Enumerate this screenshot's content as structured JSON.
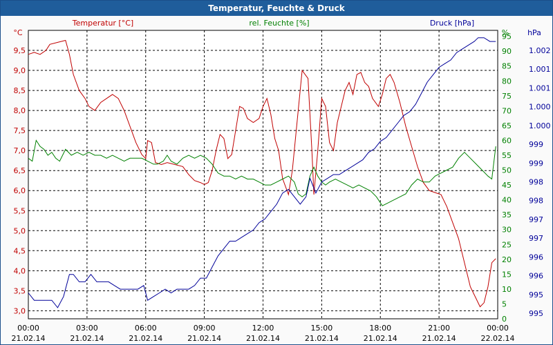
{
  "window": {
    "title": "Temperatur, Feuchte & Druck"
  },
  "chart_data": {
    "type": "line",
    "title": "Temperatur, Feuchte & Druck",
    "colors": {
      "temperature": "#c00000",
      "humidity": "#008000",
      "pressure": "#000099",
      "grid": "#000000",
      "background": "#ffffff"
    },
    "x_ticks": [
      {
        "time": "00:00",
        "date": "21.02.14"
      },
      {
        "time": "03:00",
        "date": "21.02.14"
      },
      {
        "time": "06:00",
        "date": "21.02.14"
      },
      {
        "time": "09:00",
        "date": "21.02.14"
      },
      {
        "time": "12:00",
        "date": "21.02.14"
      },
      {
        "time": "15:00",
        "date": "21.02.14"
      },
      {
        "time": "18:00",
        "date": "21.02.14"
      },
      {
        "time": "21:00",
        "date": "21.02.14"
      },
      {
        "time": "00:00",
        "date": "22.02.14"
      }
    ],
    "xlim_hours": [
      0,
      24
    ],
    "grid": true,
    "axes": {
      "temperature": {
        "label": "Temperatur [°C]",
        "unit": "°C",
        "ylim": [
          2.8,
          10.0
        ],
        "ticks": [
          "3,0",
          "3,5",
          "4,0",
          "4,5",
          "5,0",
          "5,5",
          "6,0",
          "6,5",
          "7,0",
          "7,5",
          "8,0",
          "8,5",
          "9,0",
          "9,5"
        ]
      },
      "humidity": {
        "label": "rel. Feuchte [%]",
        "unit": "%",
        "ylim": [
          0,
          97
        ],
        "ticks": [
          "0",
          "5",
          "10",
          "15",
          "20",
          "25",
          "30",
          "35",
          "40",
          "45",
          "50",
          "55",
          "60",
          "65",
          "70",
          "75",
          "80",
          "85",
          "90",
          "95"
        ]
      },
      "pressure": {
        "label": "Druck [hPa]",
        "unit": "hPa",
        "ylim": [
          994.7,
          1002.5
        ],
        "ticks": [
          "995",
          "995",
          "996",
          "996",
          "997",
          "997",
          "998",
          "998",
          "999",
          "999",
          "1.000",
          "1.000",
          "1.001",
          "1.001",
          "1.002"
        ]
      }
    },
    "series": [
      {
        "name": "Temperatur [°C]",
        "axis": "temperature",
        "points": [
          [
            0,
            9.4
          ],
          [
            0.3,
            9.45
          ],
          [
            0.6,
            9.4
          ],
          [
            0.9,
            9.5
          ],
          [
            1.1,
            9.65
          ],
          [
            1.5,
            9.7
          ],
          [
            1.9,
            9.75
          ],
          [
            2.1,
            9.4
          ],
          [
            2.3,
            8.9
          ],
          [
            2.6,
            8.5
          ],
          [
            2.9,
            8.3
          ],
          [
            3.1,
            8.1
          ],
          [
            3.4,
            8.0
          ],
          [
            3.7,
            8.2
          ],
          [
            4.0,
            8.3
          ],
          [
            4.3,
            8.4
          ],
          [
            4.6,
            8.3
          ],
          [
            4.9,
            8.0
          ],
          [
            5.2,
            7.6
          ],
          [
            5.5,
            7.2
          ],
          [
            5.8,
            6.9
          ],
          [
            6.0,
            6.8
          ],
          [
            6.1,
            7.25
          ],
          [
            6.3,
            7.2
          ],
          [
            6.5,
            6.7
          ],
          [
            6.8,
            6.65
          ],
          [
            7.1,
            6.7
          ],
          [
            7.5,
            6.65
          ],
          [
            7.9,
            6.6
          ],
          [
            8.2,
            6.4
          ],
          [
            8.5,
            6.25
          ],
          [
            8.8,
            6.2
          ],
          [
            9.0,
            6.15
          ],
          [
            9.2,
            6.2
          ],
          [
            9.4,
            6.5
          ],
          [
            9.6,
            7.0
          ],
          [
            9.8,
            7.4
          ],
          [
            10.0,
            7.3
          ],
          [
            10.2,
            6.8
          ],
          [
            10.4,
            6.9
          ],
          [
            10.6,
            7.5
          ],
          [
            10.8,
            8.1
          ],
          [
            11.0,
            8.05
          ],
          [
            11.2,
            7.8
          ],
          [
            11.5,
            7.7
          ],
          [
            11.8,
            7.8
          ],
          [
            12.0,
            8.1
          ],
          [
            12.2,
            8.3
          ],
          [
            12.4,
            7.9
          ],
          [
            12.6,
            7.3
          ],
          [
            12.8,
            7.0
          ],
          [
            13.0,
            6.3
          ],
          [
            13.3,
            5.9
          ],
          [
            13.5,
            6.5
          ],
          [
            13.8,
            8.0
          ],
          [
            14.0,
            9.0
          ],
          [
            14.3,
            8.8
          ],
          [
            14.5,
            7.0
          ],
          [
            14.6,
            5.9
          ],
          [
            14.8,
            7.0
          ],
          [
            15.0,
            8.3
          ],
          [
            15.2,
            8.1
          ],
          [
            15.4,
            7.2
          ],
          [
            15.6,
            7.0
          ],
          [
            15.8,
            7.7
          ],
          [
            16.0,
            8.1
          ],
          [
            16.2,
            8.5
          ],
          [
            16.4,
            8.7
          ],
          [
            16.6,
            8.4
          ],
          [
            16.8,
            8.9
          ],
          [
            17.0,
            8.95
          ],
          [
            17.2,
            8.7
          ],
          [
            17.4,
            8.6
          ],
          [
            17.6,
            8.3
          ],
          [
            17.9,
            8.1
          ],
          [
            18.1,
            8.4
          ],
          [
            18.3,
            8.8
          ],
          [
            18.5,
            8.9
          ],
          [
            18.7,
            8.7
          ],
          [
            19.0,
            8.2
          ],
          [
            19.3,
            7.6
          ],
          [
            19.6,
            7.1
          ],
          [
            19.9,
            6.6
          ],
          [
            20.2,
            6.2
          ],
          [
            20.5,
            6.0
          ],
          [
            20.8,
            5.95
          ],
          [
            21.1,
            5.9
          ],
          [
            21.4,
            5.6
          ],
          [
            21.7,
            5.2
          ],
          [
            22.0,
            4.8
          ],
          [
            22.3,
            4.2
          ],
          [
            22.6,
            3.6
          ],
          [
            22.9,
            3.3
          ],
          [
            23.1,
            3.1
          ],
          [
            23.3,
            3.2
          ],
          [
            23.5,
            3.6
          ],
          [
            23.7,
            4.2
          ],
          [
            23.9,
            4.3
          ]
        ]
      },
      {
        "name": "rel. Feuchte [%]",
        "axis": "humidity",
        "points": [
          [
            0,
            54
          ],
          [
            0.2,
            53
          ],
          [
            0.4,
            60
          ],
          [
            0.6,
            58
          ],
          [
            0.8,
            57
          ],
          [
            1.0,
            55
          ],
          [
            1.2,
            56
          ],
          [
            1.4,
            54
          ],
          [
            1.6,
            53
          ],
          [
            1.9,
            57
          ],
          [
            2.2,
            55
          ],
          [
            2.5,
            56
          ],
          [
            2.8,
            55
          ],
          [
            3.1,
            56
          ],
          [
            3.4,
            55
          ],
          [
            3.7,
            55
          ],
          [
            4.0,
            54
          ],
          [
            4.3,
            55
          ],
          [
            4.6,
            54
          ],
          [
            4.9,
            53
          ],
          [
            5.2,
            54
          ],
          [
            5.5,
            54
          ],
          [
            5.8,
            54
          ],
          [
            6.1,
            53
          ],
          [
            6.4,
            52
          ],
          [
            6.6,
            52
          ],
          [
            6.9,
            53
          ],
          [
            7.1,
            55
          ],
          [
            7.3,
            53
          ],
          [
            7.6,
            52
          ],
          [
            7.9,
            54
          ],
          [
            8.2,
            55
          ],
          [
            8.5,
            54
          ],
          [
            8.8,
            55
          ],
          [
            9.1,
            54
          ],
          [
            9.4,
            52
          ],
          [
            9.7,
            49
          ],
          [
            10.0,
            48
          ],
          [
            10.3,
            48
          ],
          [
            10.6,
            47
          ],
          [
            10.9,
            48
          ],
          [
            11.2,
            47
          ],
          [
            11.5,
            47
          ],
          [
            11.8,
            46
          ],
          [
            12.1,
            45
          ],
          [
            12.4,
            45
          ],
          [
            12.7,
            46
          ],
          [
            13.0,
            47
          ],
          [
            13.3,
            48
          ],
          [
            13.6,
            46
          ],
          [
            13.8,
            42
          ],
          [
            14.0,
            41
          ],
          [
            14.2,
            42
          ],
          [
            14.4,
            48
          ],
          [
            14.6,
            51
          ],
          [
            14.8,
            48
          ],
          [
            15.0,
            46
          ],
          [
            15.2,
            45
          ],
          [
            15.4,
            46
          ],
          [
            15.7,
            47
          ],
          [
            16.0,
            46
          ],
          [
            16.3,
            45
          ],
          [
            16.6,
            44
          ],
          [
            16.9,
            45
          ],
          [
            17.2,
            44
          ],
          [
            17.5,
            43
          ],
          [
            17.8,
            41
          ],
          [
            18.1,
            38
          ],
          [
            18.4,
            39
          ],
          [
            18.7,
            40
          ],
          [
            19.0,
            41
          ],
          [
            19.3,
            42
          ],
          [
            19.6,
            45
          ],
          [
            19.9,
            47
          ],
          [
            20.2,
            46
          ],
          [
            20.5,
            46
          ],
          [
            20.8,
            48
          ],
          [
            21.1,
            49
          ],
          [
            21.4,
            50
          ],
          [
            21.7,
            51
          ],
          [
            22.0,
            54
          ],
          [
            22.3,
            56
          ],
          [
            22.6,
            54
          ],
          [
            22.9,
            52
          ],
          [
            23.2,
            50
          ],
          [
            23.5,
            48
          ],
          [
            23.7,
            47
          ],
          [
            23.9,
            58
          ]
        ]
      },
      {
        "name": "Druck [hPa]",
        "axis": "pressure",
        "points": [
          [
            0,
            995.4
          ],
          [
            0.3,
            995.2
          ],
          [
            0.6,
            995.2
          ],
          [
            0.9,
            995.2
          ],
          [
            1.2,
            995.2
          ],
          [
            1.5,
            995.0
          ],
          [
            1.8,
            995.3
          ],
          [
            2.1,
            995.9
          ],
          [
            2.3,
            995.9
          ],
          [
            2.6,
            995.7
          ],
          [
            2.9,
            995.7
          ],
          [
            3.2,
            995.9
          ],
          [
            3.5,
            995.7
          ],
          [
            3.8,
            995.7
          ],
          [
            4.1,
            995.7
          ],
          [
            4.4,
            995.6
          ],
          [
            4.7,
            995.5
          ],
          [
            5.0,
            995.5
          ],
          [
            5.3,
            995.5
          ],
          [
            5.6,
            995.5
          ],
          [
            5.9,
            995.6
          ],
          [
            6.1,
            995.2
          ],
          [
            6.4,
            995.3
          ],
          [
            6.7,
            995.4
          ],
          [
            7.0,
            995.5
          ],
          [
            7.3,
            995.4
          ],
          [
            7.6,
            995.5
          ],
          [
            7.9,
            995.5
          ],
          [
            8.2,
            995.5
          ],
          [
            8.5,
            995.6
          ],
          [
            8.8,
            995.8
          ],
          [
            9.1,
            995.8
          ],
          [
            9.4,
            996.1
          ],
          [
            9.7,
            996.4
          ],
          [
            10.0,
            996.6
          ],
          [
            10.3,
            996.8
          ],
          [
            10.6,
            996.8
          ],
          [
            10.9,
            996.9
          ],
          [
            11.2,
            997.0
          ],
          [
            11.5,
            997.1
          ],
          [
            11.8,
            997.3
          ],
          [
            12.1,
            997.4
          ],
          [
            12.4,
            997.6
          ],
          [
            12.7,
            997.8
          ],
          [
            13.0,
            998.1
          ],
          [
            13.3,
            998.2
          ],
          [
            13.6,
            998.0
          ],
          [
            13.9,
            997.8
          ],
          [
            14.2,
            998.0
          ],
          [
            14.4,
            998.5
          ],
          [
            14.7,
            998.1
          ],
          [
            15.0,
            998.4
          ],
          [
            15.3,
            998.5
          ],
          [
            15.6,
            998.6
          ],
          [
            15.9,
            998.6
          ],
          [
            16.2,
            998.7
          ],
          [
            16.5,
            998.8
          ],
          [
            16.8,
            998.9
          ],
          [
            17.1,
            999.0
          ],
          [
            17.4,
            999.2
          ],
          [
            17.7,
            999.3
          ],
          [
            18.0,
            999.5
          ],
          [
            18.3,
            999.6
          ],
          [
            18.6,
            999.8
          ],
          [
            18.9,
            1000.0
          ],
          [
            19.2,
            1000.2
          ],
          [
            19.5,
            1000.3
          ],
          [
            19.8,
            1000.5
          ],
          [
            20.1,
            1000.8
          ],
          [
            20.4,
            1001.1
          ],
          [
            20.7,
            1001.3
          ],
          [
            21.0,
            1001.5
          ],
          [
            21.3,
            1001.6
          ],
          [
            21.6,
            1001.7
          ],
          [
            21.9,
            1001.9
          ],
          [
            22.2,
            1002.0
          ],
          [
            22.5,
            1002.1
          ],
          [
            22.8,
            1002.2
          ],
          [
            23.0,
            1002.3
          ],
          [
            23.3,
            1002.3
          ],
          [
            23.6,
            1002.2
          ],
          [
            23.9,
            1002.2
          ]
        ]
      }
    ]
  }
}
